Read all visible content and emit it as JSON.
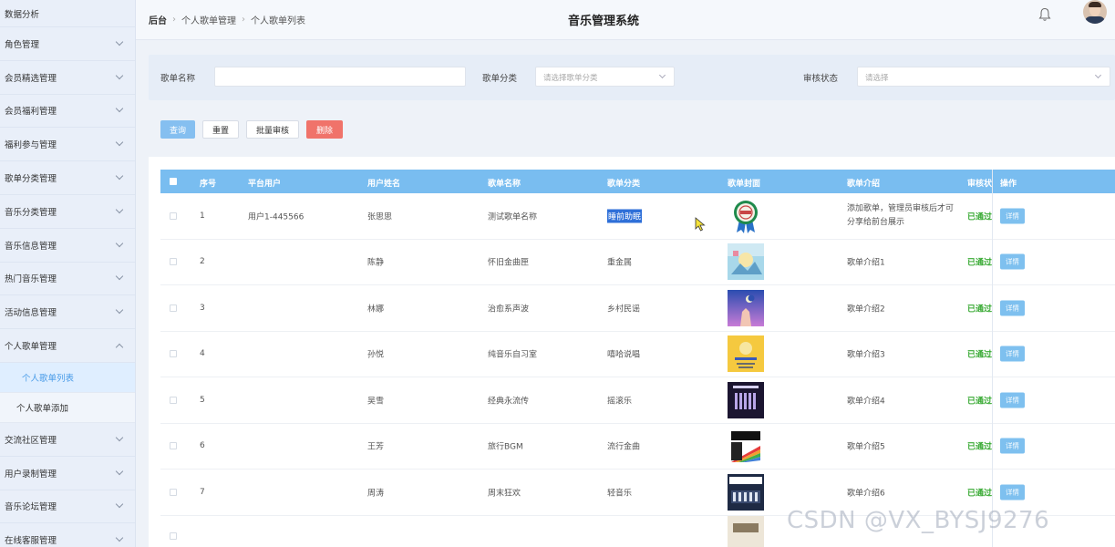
{
  "sidebar": {
    "items": [
      {
        "label": "数据分析",
        "has_chevron": false
      },
      {
        "label": "角色管理"
      },
      {
        "label": "会员精选管理"
      },
      {
        "label": "会员福利管理"
      },
      {
        "label": "福利参与管理"
      },
      {
        "label": "歌单分类管理"
      },
      {
        "label": "音乐分类管理"
      },
      {
        "label": "音乐信息管理"
      },
      {
        "label": "热门音乐管理"
      },
      {
        "label": "活动信息管理"
      },
      {
        "label": "个人歌单管理",
        "expanded": true
      },
      {
        "label": "交流社区管理"
      },
      {
        "label": "用户录制管理"
      },
      {
        "label": "音乐论坛管理"
      },
      {
        "label": "在线客服管理"
      }
    ],
    "sub_items": [
      {
        "label": "个人歌单列表",
        "active": true
      },
      {
        "label": "个人歌单添加"
      }
    ]
  },
  "header": {
    "breadcrumb": [
      "后台",
      "个人歌单管理",
      "个人歌单列表"
    ],
    "title": "音乐管理系统"
  },
  "search": {
    "name_label": "歌单名称",
    "name_value": "",
    "category_label": "歌单分类",
    "category_placeholder": "请选择歌单分类",
    "status_label": "审核状态",
    "status_placeholder": "请选择"
  },
  "actions": {
    "query": "查询",
    "reset": "重置",
    "batch_review": "批量审核",
    "delete": "删除"
  },
  "table": {
    "headers": [
      "序号",
      "平台用户",
      "用户姓名",
      "歌单名称",
      "歌单分类",
      "歌单封面",
      "歌单介绍",
      "审核状",
      "操作"
    ],
    "detail_label": "详情",
    "rows": [
      {
        "no": "1",
        "platform_user": "用户1-445566",
        "user_name": "张思思",
        "playlist_name": "测试歌单名称",
        "category": "睡前助眠",
        "intro": "添加歌单，管理员审核后才可分享给前台展示",
        "status": "已通过"
      },
      {
        "no": "2",
        "platform_user": "",
        "user_name": "陈静",
        "playlist_name": "怀旧金曲匣",
        "category": "重金属",
        "intro": "歌单介绍1",
        "status": "已通过"
      },
      {
        "no": "3",
        "platform_user": "",
        "user_name": "林娜",
        "playlist_name": "治愈系声波",
        "category": "乡村民谣",
        "intro": "歌单介绍2",
        "status": "已通过"
      },
      {
        "no": "4",
        "platform_user": "",
        "user_name": "孙悦",
        "playlist_name": "纯音乐自习室",
        "category": "嘻哈说唱",
        "intro": "歌单介绍3",
        "status": "已通过"
      },
      {
        "no": "5",
        "platform_user": "",
        "user_name": "吴雪",
        "playlist_name": "经典永流传",
        "category": "摇滚乐",
        "intro": "歌单介绍4",
        "status": "已通过"
      },
      {
        "no": "6",
        "platform_user": "",
        "user_name": "王芳",
        "playlist_name": "旅行BGM",
        "category": "流行金曲",
        "intro": "歌单介绍5",
        "status": "已通过"
      },
      {
        "no": "7",
        "platform_user": "",
        "user_name": "周涛",
        "playlist_name": "周末狂欢",
        "category": "轻音乐",
        "intro": "歌单介绍6",
        "status": "已通过"
      }
    ]
  },
  "watermark": "CSDN @VX_BYSJ9276"
}
